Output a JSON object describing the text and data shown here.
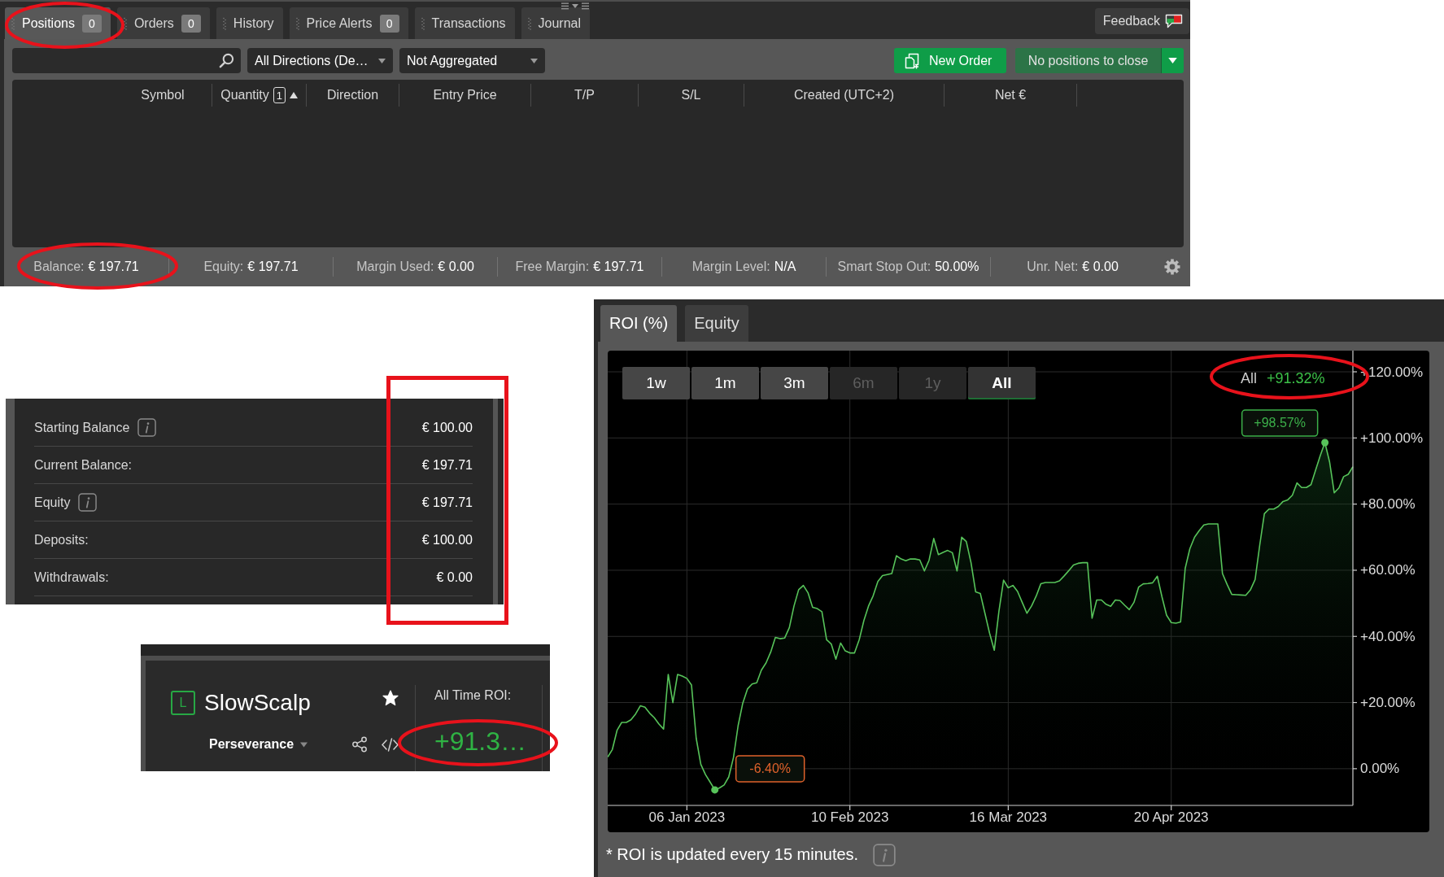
{
  "positions_panel": {
    "tabs": [
      {
        "label": "Positions",
        "count": "0",
        "selected": true
      },
      {
        "label": "Orders",
        "count": "0",
        "selected": false
      },
      {
        "label": "History",
        "selected": false
      },
      {
        "label": "Price Alerts",
        "count": "0",
        "selected": false
      },
      {
        "label": "Transactions",
        "selected": false
      },
      {
        "label": "Journal",
        "selected": false
      }
    ],
    "feedback_button": {
      "label": "Feedback"
    },
    "filters": [
      {
        "value": "All Directions (De…"
      },
      {
        "value": "Not Aggregated"
      }
    ],
    "new_order_button": {
      "label": "New Order"
    },
    "close_button": {
      "label": "No positions to close",
      "disabled": true
    },
    "table": {
      "columns": [
        {
          "label": "Symbol"
        },
        {
          "label": "Quantity",
          "sort_order": "1",
          "sort_ascending": true
        },
        {
          "label": "Direction"
        },
        {
          "label": "Entry Price"
        },
        {
          "label": "T/P"
        },
        {
          "label": "S/L"
        },
        {
          "label": "Created (UTC+2)"
        },
        {
          "label": "Net €"
        }
      ]
    },
    "status_bar": [
      {
        "label": "Balance:",
        "value": "€ 197.71"
      },
      {
        "label": "Equity:",
        "value": "€ 197.71"
      },
      {
        "label": "Margin Used:",
        "value": "€ 0.00"
      },
      {
        "label": "Free Margin:",
        "value": "€ 197.71"
      },
      {
        "label": "Margin Level:",
        "value": "N/A"
      },
      {
        "label": "Smart Stop Out:",
        "value": "50.00%"
      },
      {
        "label": "Unr. Net:",
        "value": "€ 0.00"
      }
    ]
  },
  "account_stats": {
    "rows": [
      {
        "label": "Starting Balance",
        "info": true,
        "value": "€ 100.00"
      },
      {
        "label": "Current Balance:",
        "info": false,
        "value": "€ 197.71"
      },
      {
        "label": "Equity",
        "info": true,
        "value": "€ 197.71"
      },
      {
        "label": "Deposits:",
        "info": false,
        "value": "€ 100.00"
      },
      {
        "label": "Withdrawals:",
        "info": false,
        "value": "€ 0.00"
      }
    ]
  },
  "strategy_card": {
    "badge": "L",
    "name": "SlowScalp",
    "starred": true,
    "account": "Perseverance",
    "roi_label": "All Time ROI:",
    "roi_value": "+91.3…"
  },
  "roi_chart": {
    "tabs": [
      {
        "label": "ROI (%)",
        "selected": true
      },
      {
        "label": "Equity",
        "selected": false
      }
    ],
    "ranges": [
      {
        "label": "1w",
        "selected": false,
        "disabled": false
      },
      {
        "label": "1m",
        "selected": false,
        "disabled": false
      },
      {
        "label": "3m",
        "selected": false,
        "disabled": false
      },
      {
        "label": "6m",
        "selected": false,
        "disabled": true
      },
      {
        "label": "1y",
        "selected": false,
        "disabled": true
      },
      {
        "label": "All",
        "selected": true,
        "disabled": false
      }
    ],
    "summary": {
      "range": "All",
      "value": "+91.32%"
    },
    "chart_data": {
      "type": "area",
      "grid": true,
      "categories": [
        null,
        null,
        null,
        null,
        null,
        null,
        null,
        null,
        null,
        null,
        null,
        null,
        null,
        null,
        null,
        null,
        null,
        "06 Jan 2023",
        null,
        null,
        null,
        null,
        null,
        null,
        null,
        null,
        null,
        null,
        null,
        null,
        null,
        null,
        null,
        null,
        null,
        null,
        null,
        null,
        null,
        null,
        null,
        null,
        null,
        null,
        null,
        null,
        null,
        null,
        null,
        null,
        null,
        null,
        "10 Feb 2023",
        null,
        null,
        null,
        null,
        null,
        null,
        null,
        null,
        null,
        null,
        null,
        null,
        null,
        null,
        null,
        null,
        null,
        null,
        null,
        null,
        null,
        null,
        null,
        null,
        null,
        null,
        null,
        null,
        null,
        null,
        null,
        null,
        null,
        "16 Mar 2023",
        null,
        null,
        null,
        null,
        null,
        null,
        null,
        null,
        null,
        null,
        null,
        null,
        null,
        null,
        null,
        null,
        null,
        null,
        null,
        null,
        null,
        null,
        null,
        null,
        null,
        null,
        null,
        null,
        null,
        null,
        null,
        null,
        null,
        null,
        "20 Apr 2023",
        null,
        null,
        null,
        null,
        null,
        null,
        null,
        null,
        null,
        null,
        null,
        null,
        null,
        null,
        null,
        null,
        null,
        null,
        null,
        null,
        null,
        null,
        null,
        null,
        null,
        null,
        null,
        null,
        null,
        null,
        null,
        null,
        null,
        null,
        null,
        null,
        null,
        null,
        null
      ],
      "series": [
        {
          "color": "#57c35a",
          "values": [
            3.5,
            5.8,
            11.6,
            14,
            14,
            14.8,
            16.6,
            19,
            18.6,
            16.8,
            15.4,
            13.5,
            12,
            28.5,
            20,
            28.5,
            28,
            27.3,
            25.3,
            9.2,
            1.3,
            -1.8,
            -4.1,
            -6.4,
            -5.8,
            -4.9,
            -2.5,
            3.4,
            13,
            19.8,
            24.1,
            25.6,
            26,
            29.8,
            32,
            35.3,
            39.7,
            39.3,
            39.5,
            42.7,
            49.2,
            54.1,
            55.4,
            53.2,
            48.8,
            48.4,
            47.5,
            39,
            37.7,
            33.1,
            38,
            35.6,
            35,
            35,
            39,
            44.8,
            49.2,
            52.3,
            56.6,
            58.4,
            58.7,
            59,
            64.4,
            63.4,
            62.9,
            63.4,
            63.4,
            63.1,
            59.8,
            63,
            69.6,
            64.7,
            65.4,
            66,
            65.3,
            59.8,
            70,
            68.7,
            62.3,
            53.5,
            53,
            47,
            41,
            35.8,
            47.6,
            57,
            54.7,
            55.4,
            53.6,
            50.3,
            47,
            49.2,
            52.2,
            55.9,
            56.3,
            56.3,
            56.3,
            56.8,
            58.3,
            59.9,
            61.6,
            62.1,
            62.3,
            62.3,
            45.5,
            51,
            51,
            49.7,
            49.1,
            51,
            50.8,
            49.4,
            48.1,
            50.3,
            54.9,
            55.9,
            56,
            56.2,
            58.2,
            52,
            46.4,
            44.2,
            44,
            44.4,
            60.6,
            66.5,
            70,
            72,
            73.7,
            74,
            74,
            74,
            59,
            55.7,
            52.7,
            52.6,
            52.5,
            52.4,
            54.1,
            57.2,
            67.6,
            77.1,
            78.5,
            78.5,
            79.3,
            80.8,
            81.3,
            82.7,
            86.4,
            85,
            85,
            85.9,
            90.3,
            94.7,
            98.6,
            92.7,
            83.4,
            84.9,
            88.3,
            89,
            91.3
          ]
        }
      ],
      "ylim": [
        -11.1,
        126.4
      ],
      "yticks": [
        {
          "value": 120,
          "label": "+120.00%"
        },
        {
          "value": 100,
          "label": "+100.00%"
        },
        {
          "value": 80,
          "label": "+80.00%"
        },
        {
          "value": 60,
          "label": "+60.00%"
        },
        {
          "value": 40,
          "label": "+40.00%"
        },
        {
          "value": 20,
          "label": "+20.00%"
        },
        {
          "value": 0,
          "label": "0.00%"
        }
      ],
      "annotations": [
        "+98.57%",
        "-6.40%"
      ]
    },
    "footnote": "* ROI is updated every 15 minutes."
  }
}
